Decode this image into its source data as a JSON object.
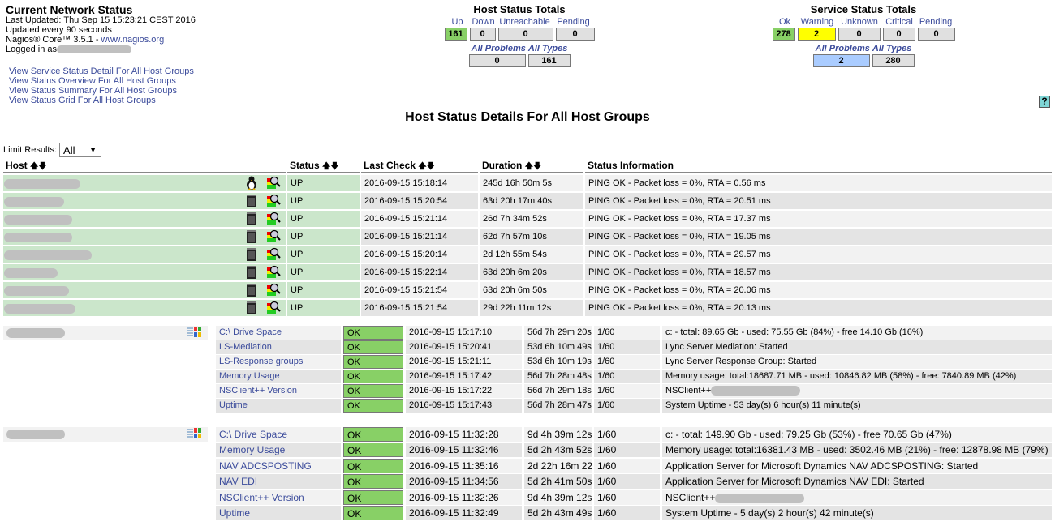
{
  "info": {
    "title": "Current Network Status",
    "last_updated": "Last Updated: Thu Sep 15 15:23:21 CEST 2016",
    "interval": "Updated every 90 seconds",
    "version": "Nagios® Core™ 3.5.1 - ",
    "site": "www.nagios.org",
    "logged_in": "Logged in as"
  },
  "links": [
    "View Service Status Detail For All Host Groups",
    "View Status Overview For All Host Groups",
    "View Status Summary For All Host Groups",
    "View Status Grid For All Host Groups"
  ],
  "host_totals": {
    "title": "Host Status Totals",
    "labels": [
      "Up",
      "Down",
      "Unreachable",
      "Pending"
    ],
    "values": [
      "161",
      "0",
      "0",
      "0"
    ],
    "all_problems_label": "All Problems",
    "all_types_label": "All Types",
    "all_problems": "0",
    "all_types": "161"
  },
  "service_totals": {
    "title": "Service Status Totals",
    "labels": [
      "Ok",
      "Warning",
      "Unknown",
      "Critical",
      "Pending"
    ],
    "values": [
      "278",
      "2",
      "0",
      "0",
      "0"
    ],
    "all_problems_label": "All Problems",
    "all_types_label": "All Types",
    "all_problems": "2",
    "all_types": "280"
  },
  "colors": {
    "ok": "#88d066",
    "warning": "#ffff00",
    "problems": "#aaccff",
    "up_row": "#cbe6cb"
  },
  "help": "?",
  "page_title": "Host Status Details For All Host Groups",
  "limit": {
    "label": "Limit Results:",
    "value": "All"
  },
  "host_columns": [
    "Host",
    "Status",
    "Last Check",
    "Duration",
    "Status Information"
  ],
  "hosts": [
    {
      "os": "linux-icon",
      "status": "UP",
      "last_check": "2016-09-15 15:18:14",
      "duration": "245d 16h 50m 5s",
      "info": "PING OK - Packet loss = 0%, RTA = 0.56 ms"
    },
    {
      "os": "server-icon",
      "status": "UP",
      "last_check": "2016-09-15 15:20:54",
      "duration": "63d 20h 17m 40s",
      "info": "PING OK - Packet loss = 0%, RTA = 20.51 ms"
    },
    {
      "os": "server-icon",
      "status": "UP",
      "last_check": "2016-09-15 15:21:14",
      "duration": "26d 7h 34m 52s",
      "info": "PING OK - Packet loss = 0%, RTA = 17.37 ms"
    },
    {
      "os": "server-icon",
      "status": "UP",
      "last_check": "2016-09-15 15:21:14",
      "duration": "62d 7h 57m 10s",
      "info": "PING OK - Packet loss = 0%, RTA = 19.05 ms"
    },
    {
      "os": "server-icon",
      "status": "UP",
      "last_check": "2016-09-15 15:20:14",
      "duration": "2d 12h 55m 54s",
      "info": "PING OK - Packet loss = 0%, RTA = 29.57 ms"
    },
    {
      "os": "server-icon",
      "status": "UP",
      "last_check": "2016-09-15 15:22:14",
      "duration": "63d 20h 6m 20s",
      "info": "PING OK - Packet loss = 0%, RTA = 18.57 ms"
    },
    {
      "os": "server-icon",
      "status": "UP",
      "last_check": "2016-09-15 15:21:54",
      "duration": "63d 20h 6m 50s",
      "info": "PING OK - Packet loss = 0%, RTA = 20.06 ms"
    },
    {
      "os": "server-icon",
      "status": "UP",
      "last_check": "2016-09-15 15:21:54",
      "duration": "29d 22h 11m 12s",
      "info": "PING OK - Packet loss = 0%, RTA = 20.13 ms"
    }
  ],
  "service_groups": [
    {
      "services": [
        {
          "name": "C:\\ Drive Space",
          "status": "OK",
          "last_check": "2016-09-15 15:17:10",
          "duration": "56d 7h 29m 20s",
          "attempt": "1/60",
          "info": "c: - total: 89.65 Gb - used: 75.55 Gb (84%) - free 14.10 Gb (16%)"
        },
        {
          "name": "LS-Mediation",
          "status": "OK",
          "last_check": "2016-09-15 15:20:41",
          "duration": "53d 6h 10m 49s",
          "attempt": "1/60",
          "info": "Lync Server Mediation: Started"
        },
        {
          "name": "LS-Response groups",
          "status": "OK",
          "last_check": "2016-09-15 15:21:11",
          "duration": "53d 6h 10m 19s",
          "attempt": "1/60",
          "info": "Lync Server Response Group: Started"
        },
        {
          "name": "Memory Usage",
          "status": "OK",
          "last_check": "2016-09-15 15:17:42",
          "duration": "56d 7h 28m 48s",
          "attempt": "1/60",
          "info": "Memory usage: total:18687.71 MB - used: 10846.82 MB (58%) - free: 7840.89 MB (42%)"
        },
        {
          "name": "NSClient++ Version",
          "status": "OK",
          "last_check": "2016-09-15 15:17:22",
          "duration": "56d 7h 29m 18s",
          "attempt": "1/60",
          "info": "NSClient++"
        },
        {
          "name": "Uptime",
          "status": "OK",
          "last_check": "2016-09-15 15:17:43",
          "duration": "56d 7h 28m 47s",
          "attempt": "1/60",
          "info": "System Uptime - 53 day(s) 6 hour(s) 11 minute(s)"
        }
      ]
    },
    {
      "services": [
        {
          "name": "C:\\ Drive Space",
          "status": "OK",
          "last_check": "2016-09-15 11:32:28",
          "duration": "9d 4h 39m 12s",
          "attempt": "1/60",
          "info": "c: - total: 149.90 Gb - used: 79.25 Gb (53%) - free 70.65 Gb (47%)"
        },
        {
          "name": "Memory Usage",
          "status": "OK",
          "last_check": "2016-09-15 11:32:46",
          "duration": "5d 2h 43m 52s",
          "attempt": "1/60",
          "info": "Memory usage: total:16381.43 MB - used: 3502.46 MB (21%) - free: 12878.98 MB (79%)"
        },
        {
          "name": "NAV ADCSPOSTING",
          "status": "OK",
          "last_check": "2016-09-15 11:35:16",
          "duration": "2d 22h 16m 22s",
          "attempt": "1/60",
          "info": "Application Server for Microsoft Dynamics NAV ADCSPOSTING: Started"
        },
        {
          "name": "NAV EDI",
          "status": "OK",
          "last_check": "2016-09-15 11:34:56",
          "duration": "5d 2h 41m 50s",
          "attempt": "1/60",
          "info": "Application Server for Microsoft Dynamics NAV EDI: Started"
        },
        {
          "name": "NSClient++ Version",
          "status": "OK",
          "last_check": "2016-09-15 11:32:26",
          "duration": "9d 4h 39m 12s",
          "attempt": "1/60",
          "info": "NSClient++"
        },
        {
          "name": "Uptime",
          "status": "OK",
          "last_check": "2016-09-15 11:32:49",
          "duration": "5d 2h 43m 49s",
          "attempt": "1/60",
          "info": "System Uptime - 5 day(s) 2 hour(s) 42 minute(s)"
        }
      ]
    }
  ]
}
